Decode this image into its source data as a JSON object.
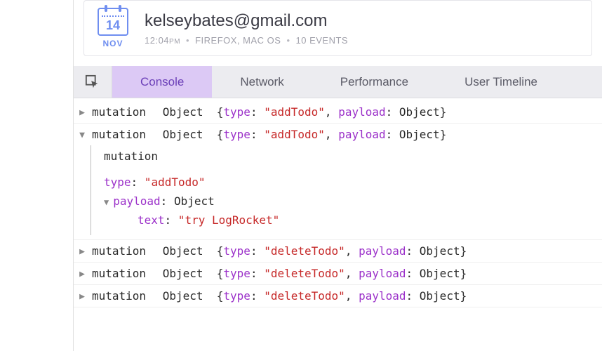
{
  "session": {
    "day": "14",
    "month": "NOV",
    "email": "kelseybates@gmail.com",
    "time": "12:04",
    "ampm": "PM",
    "browser": "FIREFOX, MAC OS",
    "events": "10 EVENTS"
  },
  "tabs": {
    "console": "Console",
    "network": "Network",
    "performance": "Performance",
    "timeline": "User Timeline"
  },
  "console": {
    "rows": [
      {
        "label": "mutation",
        "type": "addTodo",
        "expanded": false
      },
      {
        "label": "mutation",
        "type": "addTodo",
        "expanded": true,
        "detail": {
          "headerLabel": "mutation",
          "typeKey": "type",
          "typeVal": "addTodo",
          "payloadKey": "payload",
          "payloadType": "Object",
          "textKey": "text",
          "textVal": "try LogRocket"
        }
      },
      {
        "label": "mutation",
        "type": "deleteTodo",
        "expanded": false
      },
      {
        "label": "mutation",
        "type": "deleteTodo",
        "expanded": false
      },
      {
        "label": "mutation",
        "type": "deleteTodo",
        "expanded": false
      }
    ],
    "objectWord": "Object",
    "typeKey": "type",
    "payloadKey": "payload"
  }
}
